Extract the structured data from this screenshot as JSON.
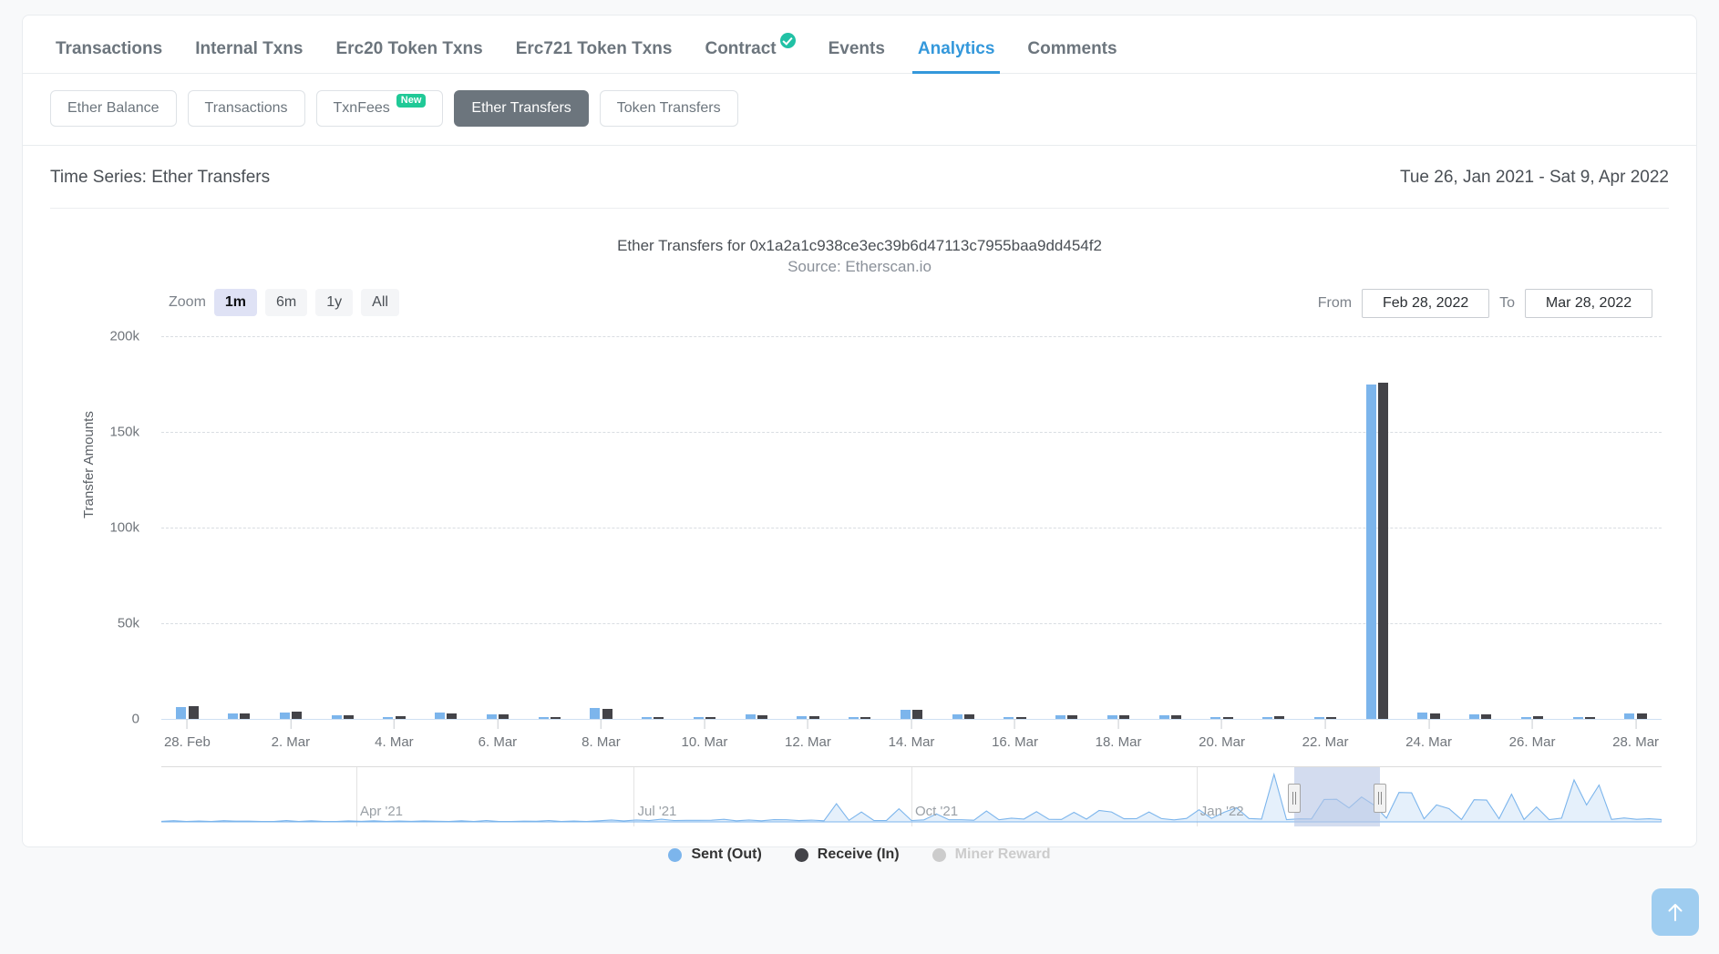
{
  "tabs": [
    {
      "label": "Transactions",
      "active": false,
      "verified": false
    },
    {
      "label": "Internal Txns",
      "active": false,
      "verified": false
    },
    {
      "label": "Erc20 Token Txns",
      "active": false,
      "verified": false
    },
    {
      "label": "Erc721 Token Txns",
      "active": false,
      "verified": false
    },
    {
      "label": "Contract",
      "active": false,
      "verified": true
    },
    {
      "label": "Events",
      "active": false,
      "verified": false
    },
    {
      "label": "Analytics",
      "active": true,
      "verified": false
    },
    {
      "label": "Comments",
      "active": false,
      "verified": false
    }
  ],
  "pills": [
    {
      "label": "Ether Balance",
      "selected": false,
      "badge": null
    },
    {
      "label": "Transactions",
      "selected": false,
      "badge": null
    },
    {
      "label": "TxnFees",
      "selected": false,
      "badge": "New"
    },
    {
      "label": "Ether Transfers",
      "selected": true,
      "badge": null
    },
    {
      "label": "Token Transfers",
      "selected": false,
      "badge": null
    }
  ],
  "panel": {
    "title": "Time Series: Ether Transfers",
    "date_range": "Tue 26, Jan 2021 - Sat 9, Apr 2022"
  },
  "controls": {
    "zoom_label": "Zoom",
    "zoom_options": [
      {
        "label": "1m",
        "active": true
      },
      {
        "label": "6m",
        "active": false
      },
      {
        "label": "1y",
        "active": false
      },
      {
        "label": "All",
        "active": false
      }
    ],
    "from_label": "From",
    "from_value": "Feb 28, 2022",
    "to_label": "To",
    "to_value": "Mar 28, 2022"
  },
  "scroll_top_icon": "arrow-up-icon",
  "colors": {
    "sent": "#7cb5ec",
    "receive": "#434348",
    "miner_reward": "#cccccc",
    "accent": "#3498db",
    "selection": "#b6c4e4"
  },
  "chart_data": {
    "type": "bar",
    "title": "Ether Transfers for 0x1a2a1c938ce3ec39b6d47113c7955baa9dd454f2",
    "subtitle": "Source: Etherscan.io",
    "xlabel": "",
    "ylabel": "Transfer Amounts",
    "ylim": [
      0,
      200000
    ],
    "yticks": [
      0,
      50000,
      100000,
      150000,
      200000
    ],
    "ytick_labels": [
      "0",
      "50k",
      "100k",
      "150k",
      "200k"
    ],
    "xtick_labels": [
      "28. Feb",
      "2. Mar",
      "4. Mar",
      "6. Mar",
      "8. Mar",
      "10. Mar",
      "12. Mar",
      "14. Mar",
      "16. Mar",
      "18. Mar",
      "20. Mar",
      "22. Mar",
      "24. Mar",
      "26. Mar",
      "28. Mar"
    ],
    "grid": true,
    "legend_position": "bottom",
    "x": [
      "2022-02-28",
      "2022-03-01",
      "2022-03-02",
      "2022-03-03",
      "2022-03-04",
      "2022-03-05",
      "2022-03-06",
      "2022-03-07",
      "2022-03-08",
      "2022-03-09",
      "2022-03-10",
      "2022-03-11",
      "2022-03-12",
      "2022-03-13",
      "2022-03-14",
      "2022-03-15",
      "2022-03-16",
      "2022-03-17",
      "2022-03-18",
      "2022-03-19",
      "2022-03-20",
      "2022-03-21",
      "2022-03-22",
      "2022-03-23",
      "2022-03-24",
      "2022-03-25",
      "2022-03-26",
      "2022-03-27",
      "2022-03-28"
    ],
    "series": [
      {
        "name": "Sent (Out)",
        "color": "#7cb5ec",
        "visible": true,
        "values": [
          6200,
          3000,
          3400,
          1700,
          800,
          3200,
          2600,
          900,
          5500,
          500,
          400,
          2300,
          1400,
          600,
          5000,
          2200,
          700,
          1900,
          1800,
          2000,
          700,
          1000,
          900,
          175000,
          3200,
          2600,
          1100,
          1000,
          3000
        ]
      },
      {
        "name": "Receive (In)",
        "color": "#434348",
        "visible": true,
        "values": [
          6800,
          3100,
          3600,
          1800,
          1300,
          2800,
          2400,
          1100,
          5200,
          800,
          700,
          2100,
          1600,
          900,
          4600,
          2400,
          1000,
          2000,
          1700,
          2100,
          900,
          1200,
          1100,
          175500,
          3000,
          2500,
          1200,
          1100,
          3100
        ]
      },
      {
        "name": "Miner Reward",
        "color": "#cccccc",
        "visible": false,
        "values": []
      }
    ],
    "navigator": {
      "tick_labels": [
        "Apr '21",
        "Jul '21",
        "Oct '21",
        "Jan '22"
      ],
      "selection_from": "Feb 28, 2022",
      "selection_to": "Mar 28, 2022"
    }
  }
}
